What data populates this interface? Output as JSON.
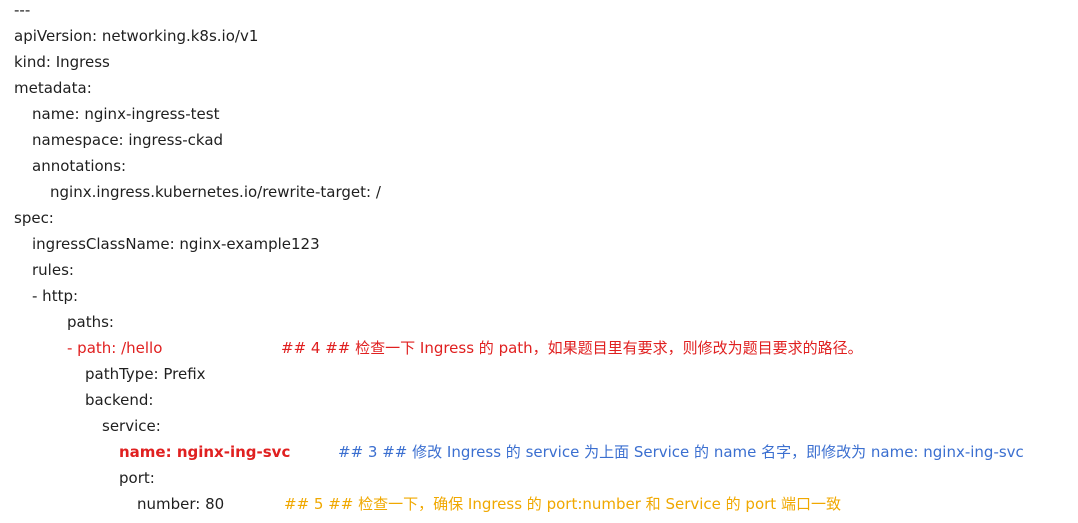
{
  "lines": {
    "l0": "---",
    "l1": "apiVersion: networking.k8s.io/v1",
    "l2": "kind: Ingress",
    "l3": "metadata:",
    "l4": "name: nginx-ingress-test",
    "l5": "namespace: ingress-ckad",
    "l6": "annotations:",
    "l7": "nginx.ingress.kubernetes.io/rewrite-target: /",
    "l8": "spec:",
    "l9": "ingressClassName: nginx-example123",
    "l10": "rules:",
    "l11": "- http:",
    "l12": "paths:",
    "l13": "- path: /hello",
    "l14": "pathType: Prefix",
    "l15": "backend:",
    "l16": "service:",
    "l17": "name: nginx-ing-svc",
    "l18": "port:",
    "l19": "number: 80"
  },
  "comments": {
    "c13": "## 4 ##  检查一下 Ingress 的 path，如果题目里有要求，则修改为题目要求的路径。",
    "c17": "## 3 ##  修改 Ingress 的 service 为上面 Service 的 name 名字，即修改为  name: nginx-ing-svc",
    "c19": "## 5 ##  检查一下，确保 Ingress 的 port:number 和 Service 的 port 端口一致"
  },
  "colors": {
    "text": "#1f1f1f",
    "red": "#e02020",
    "blue": "#3b6fd0",
    "orange": "#f0a800"
  }
}
